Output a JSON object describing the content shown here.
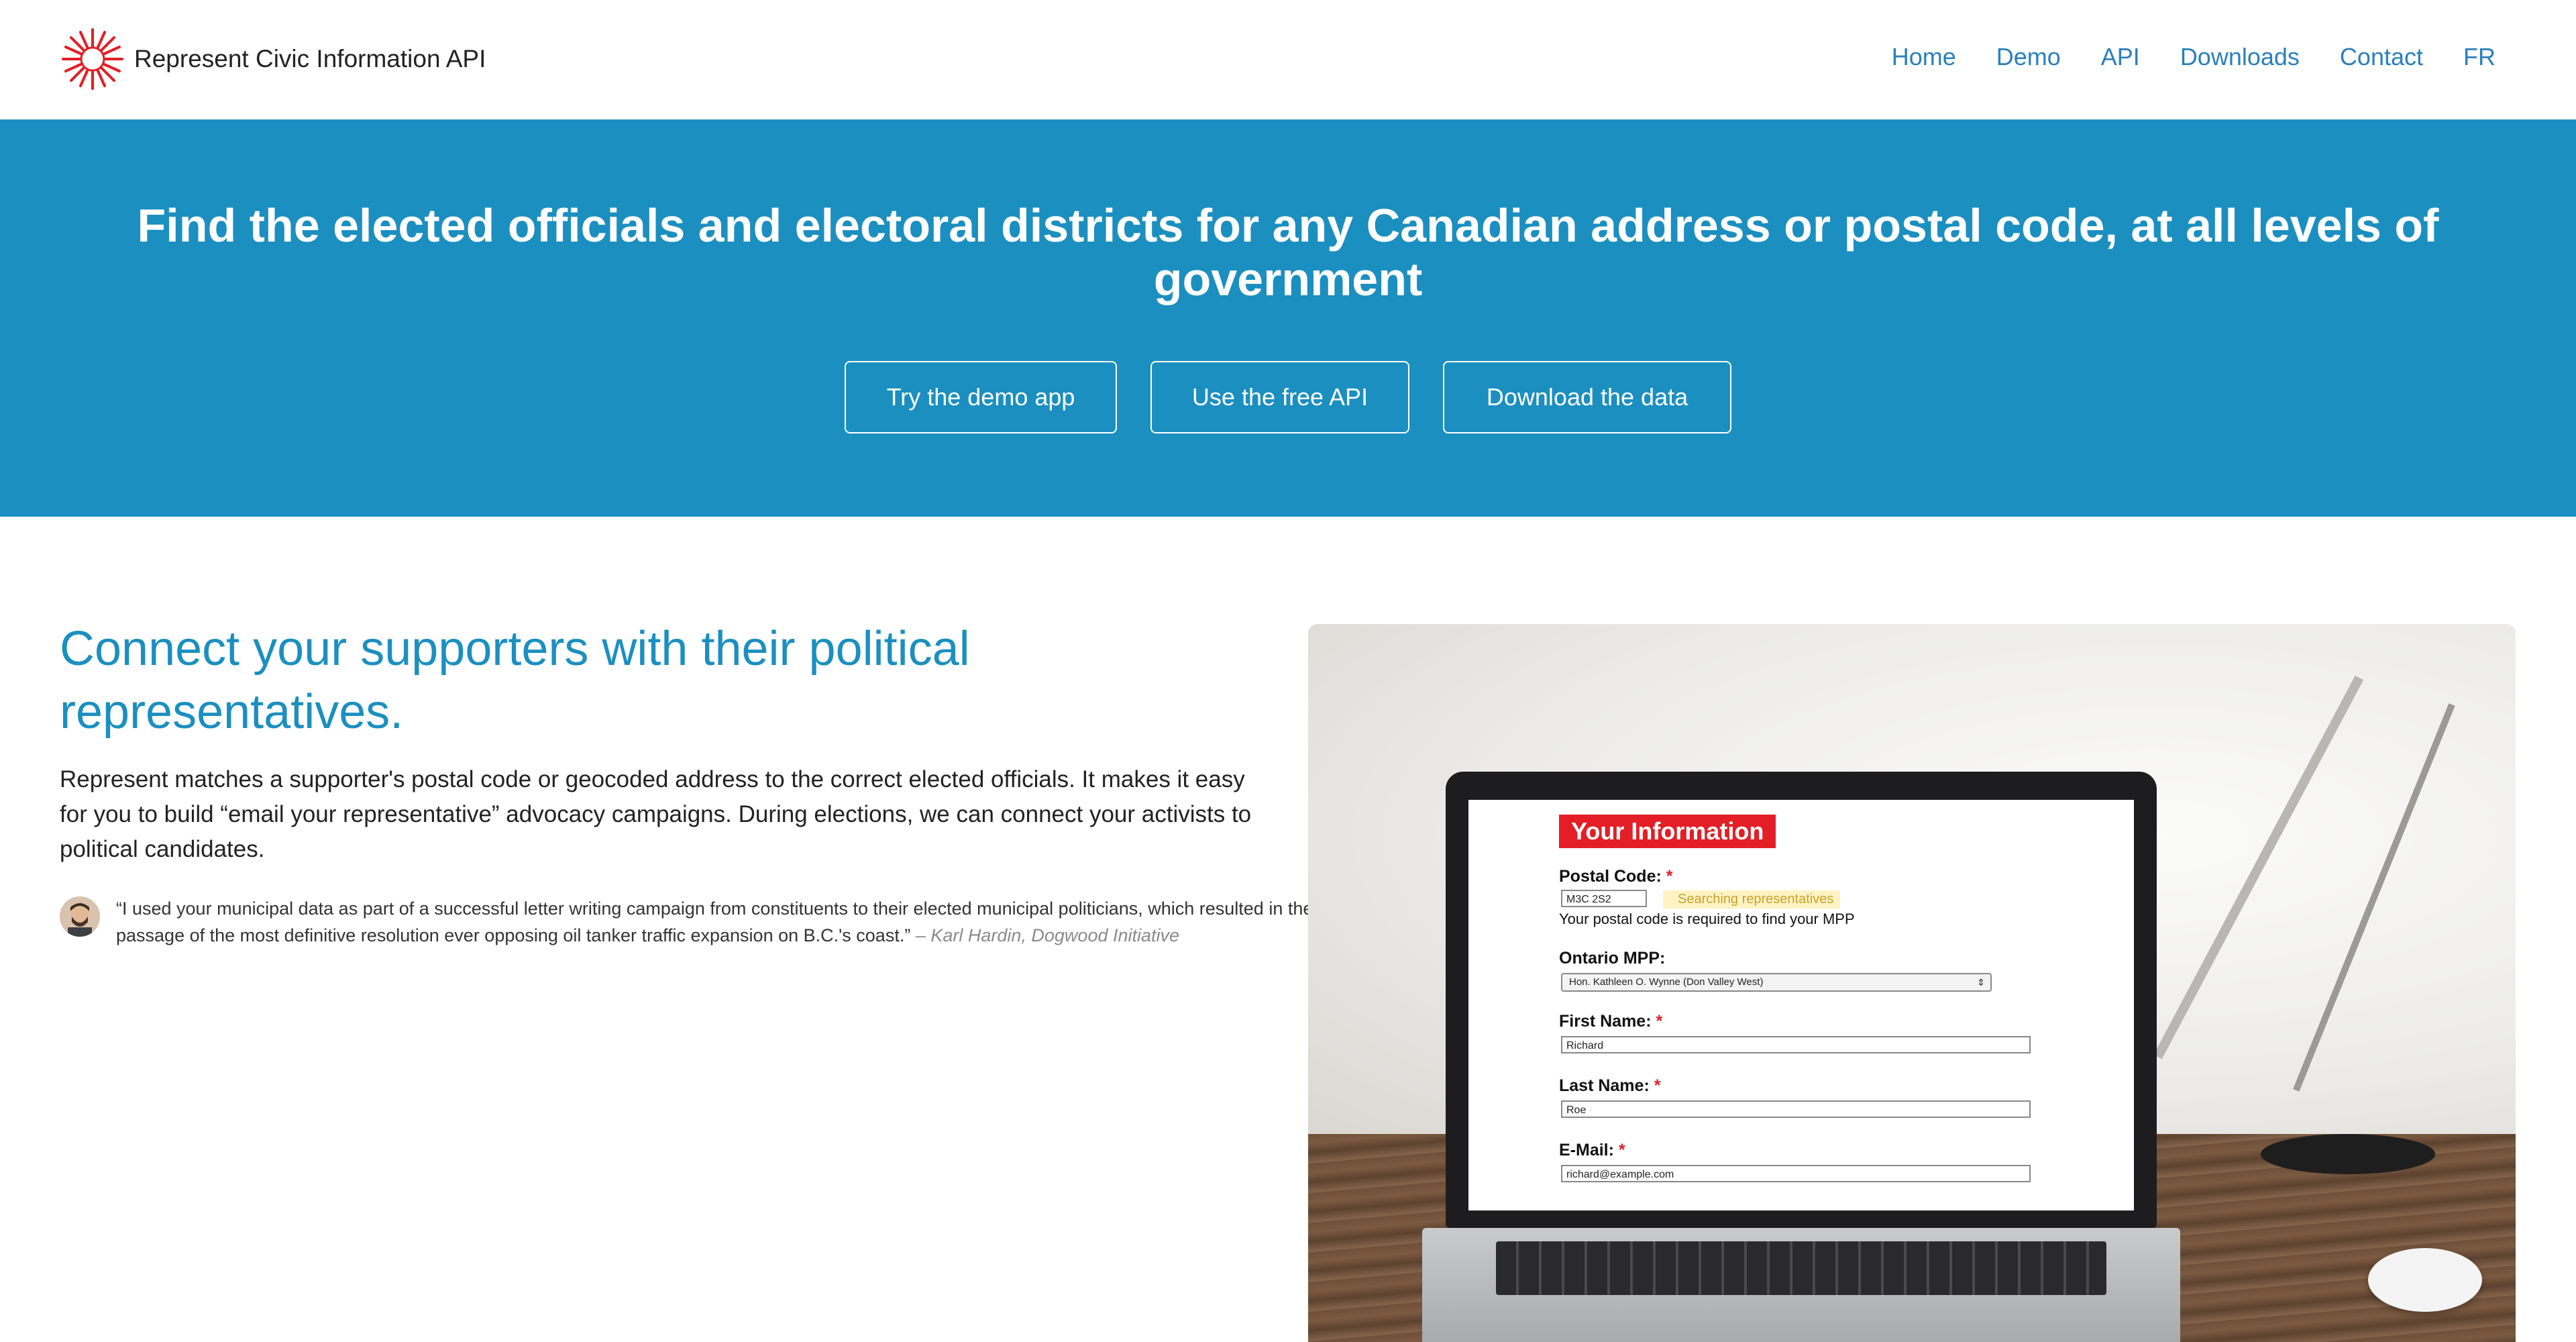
{
  "brand": {
    "name": "Represent Civic Information API",
    "logo_icon": "red-starburst-logo",
    "accent_color": "#e31e24"
  },
  "nav": {
    "items": [
      "Home",
      "Demo",
      "API",
      "Downloads",
      "Contact",
      "FR"
    ],
    "link_color": "#2a7fbd"
  },
  "hero": {
    "title": "Find the elected officials and electoral districts for any Canadian address or postal code, at all levels of government",
    "background_color": "#1b8fc0",
    "buttons": [
      "Try the demo app",
      "Use the free API",
      "Download the data"
    ]
  },
  "main": {
    "heading": "Connect your supporters with their political representatives.",
    "intro": "Represent matches a supporter's postal code or geocoded address to the correct elected officials. It makes it easy for you to build “email your representative” advocacy campaigns. During elections, we can connect your activists to political candidates.",
    "testimonial": {
      "avatar_icon": "person-avatar",
      "quote": "“I used your municipal data as part of a successful letter writing campaign from constituents to their elected municipal politicians, which resulted in the passage of the most definitive resolution ever opposing oil tanker traffic expansion on B.C.'s coast.”",
      "attribution": "– Karl Hardin, Dogwood Initiative"
    }
  },
  "screen_form": {
    "banner": "Your Information",
    "postal_code_label": "Postal Code:",
    "postal_code_value": "M3C 2S2",
    "searching_text": "Searching representatives",
    "help_text": "Your postal code is required to find your MPP",
    "mpp_label": "Ontario MPP:",
    "mpp_value": "Hon. Kathleen O. Wynne (Don Valley West)",
    "first_name_label": "First Name:",
    "first_name_value": "Richard",
    "last_name_label": "Last Name:",
    "last_name_value": "Roe",
    "email_label": "E-Mail:",
    "email_value": "richard@example.com",
    "required_mark": "*"
  }
}
